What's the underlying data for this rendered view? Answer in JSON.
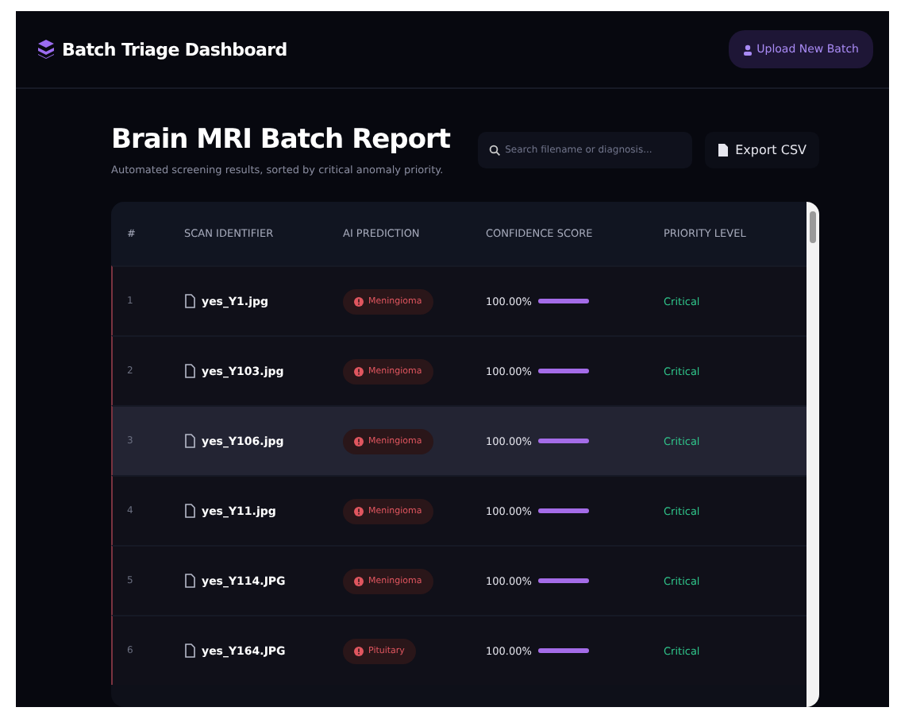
{
  "header": {
    "title": "Batch Triage Dashboard",
    "upload_button": "Upload New Batch"
  },
  "report": {
    "title": "Brain MRI Batch Report",
    "subtitle": "Automated screening results, sorted by critical anomaly priority.",
    "search": {
      "placeholder": "Search filename or diagnosis..."
    },
    "export_button": "Export CSV"
  },
  "table": {
    "columns": [
      "#",
      "SCAN IDENTIFIER",
      "AI PREDICTION",
      "CONFIDENCE SCORE",
      "PRIORITY LEVEL"
    ],
    "rows": [
      {
        "index": "1",
        "file": "yes_Y1.jpg",
        "prediction": "Meningioma",
        "confidence": "100.00%",
        "level": 1,
        "priority": "Critical",
        "highlighted": false
      },
      {
        "index": "2",
        "file": "yes_Y103.jpg",
        "prediction": "Meningioma",
        "confidence": "100.00%",
        "level": 1,
        "priority": "Critical",
        "highlighted": false
      },
      {
        "index": "3",
        "file": "yes_Y106.jpg",
        "prediction": "Meningioma",
        "confidence": "100.00%",
        "level": 1,
        "priority": "Critical",
        "highlighted": true
      },
      {
        "index": "4",
        "file": "yes_Y11.jpg",
        "prediction": "Meningioma",
        "confidence": "100.00%",
        "level": 1,
        "priority": "Critical",
        "highlighted": false
      },
      {
        "index": "5",
        "file": "yes_Y114.JPG",
        "prediction": "Meningioma",
        "confidence": "100.00%",
        "level": 1,
        "priority": "Critical",
        "highlighted": false
      },
      {
        "index": "6",
        "file": "yes_Y164.JPG",
        "prediction": "Pituitary",
        "confidence": "100.00%",
        "level": 1,
        "priority": "Critical",
        "highlighted": false
      }
    ]
  }
}
